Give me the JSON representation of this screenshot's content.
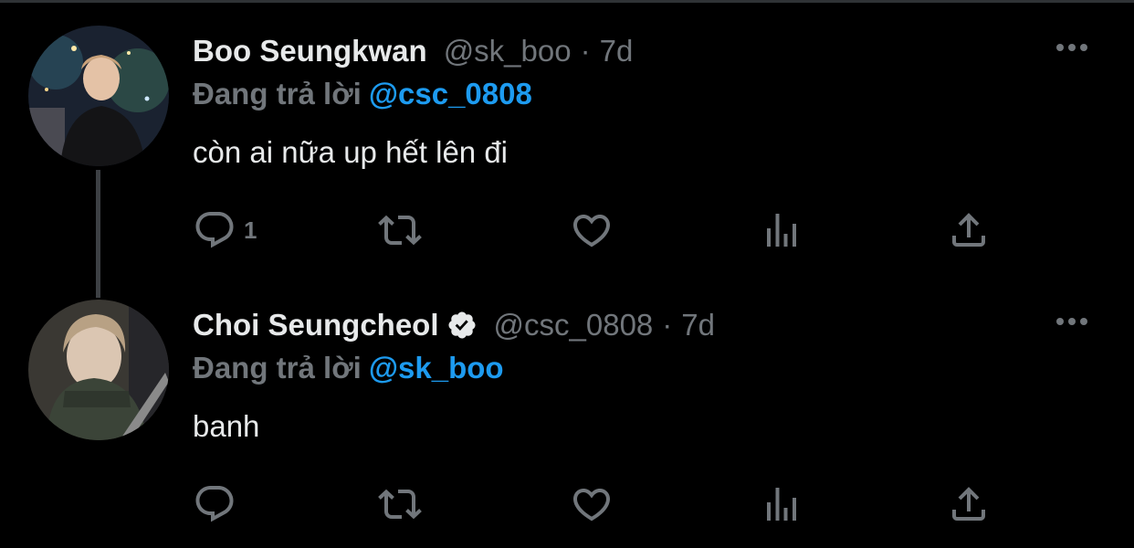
{
  "colors": {
    "background": "#000000",
    "text": "#e7e9ea",
    "muted": "#71767b",
    "accent": "#1d9bf0"
  },
  "tweets": [
    {
      "name": "Boo Seungkwan",
      "verified": false,
      "handle": "@sk_boo",
      "dot": "·",
      "time": "7d",
      "reply_prefix": "Đang trả lời",
      "reply_to": "@csc_0808",
      "text": "còn ai nữa up hết lên đi",
      "reply_count": "1",
      "avatar": "avatar-boo-seungkwan",
      "icons": [
        "reply-icon",
        "retweet-icon",
        "like-icon",
        "views-icon",
        "share-icon",
        "more-icon"
      ]
    },
    {
      "name": "Choi Seungcheol",
      "verified": true,
      "handle": "@csc_0808",
      "dot": "·",
      "time": "7d",
      "reply_prefix": "Đang trả lời",
      "reply_to": "@sk_boo",
      "text": "banh",
      "reply_count": "",
      "avatar": "avatar-choi-seungcheol",
      "icons": [
        "verified-badge-icon",
        "reply-icon",
        "retweet-icon",
        "like-icon",
        "views-icon",
        "share-icon",
        "more-icon"
      ]
    }
  ]
}
